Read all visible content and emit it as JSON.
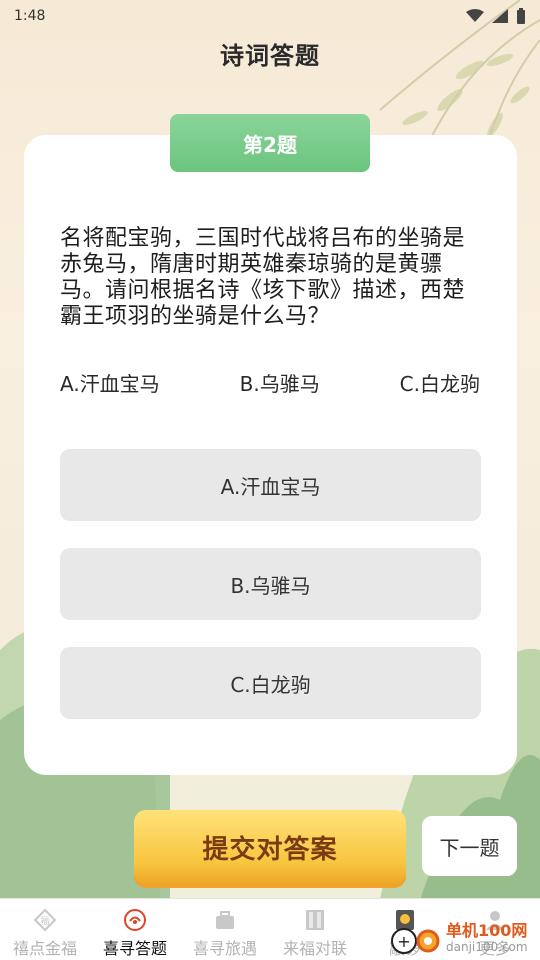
{
  "status": {
    "time": "1:48"
  },
  "header": {
    "title": "诗词答题"
  },
  "question": {
    "tag": "第2题",
    "text": "名将配宝驹，三国时代战将吕布的坐骑是赤兔马，隋唐时期英雄秦琼骑的是黄骠马。请问根据名诗《垓下歌》描述，西楚霸王项羽的坐骑是什么马？",
    "inline_options": [
      "A.汗血宝马",
      "B.乌骓马",
      "C.白龙驹"
    ],
    "choices": [
      "A.汗血宝马",
      "B.乌骓马",
      "C.白龙驹"
    ]
  },
  "actions": {
    "submit_label": "提交对答案",
    "next_label": "下一题"
  },
  "tabs": [
    {
      "label": "禧点金福",
      "active": false
    },
    {
      "label": "喜寻答题",
      "active": true
    },
    {
      "label": "喜寻旅遇",
      "active": false
    },
    {
      "label": "来福对联",
      "active": false
    },
    {
      "label": "敲锣",
      "active": false
    },
    {
      "label": "更多",
      "active": false
    }
  ],
  "watermark": {
    "name": "单机100网",
    "url": "danji100.com"
  },
  "colors": {
    "tag_green": "#6bc47e",
    "submit_gold": "#f8c640",
    "submit_text": "#7a3b12",
    "option_gray": "#e8e8e8",
    "tab_active": "#111111",
    "tab_inactive": "#b3b3b3"
  }
}
